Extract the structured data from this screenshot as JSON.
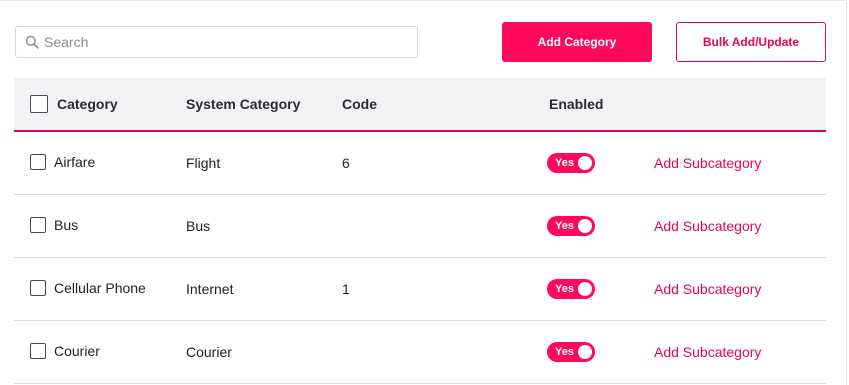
{
  "search": {
    "placeholder": "Search",
    "value": ""
  },
  "toolbar": {
    "add_category_label": "Add Category",
    "bulk_label": "Bulk Add/Update"
  },
  "table": {
    "headers": {
      "category": "Category",
      "system_category": "System Category",
      "code": "Code",
      "enabled": "Enabled"
    },
    "rows": [
      {
        "category": "Airfare",
        "system_category": "Flight",
        "code": "6",
        "enabled": "Yes",
        "action": "Add Subcategory"
      },
      {
        "category": "Bus",
        "system_category": "Bus",
        "code": "",
        "enabled": "Yes",
        "action": "Add Subcategory"
      },
      {
        "category": "Cellular Phone",
        "system_category": "Internet",
        "code": "1",
        "enabled": "Yes",
        "action": "Add Subcategory"
      },
      {
        "category": "Courier",
        "system_category": "Courier",
        "code": "",
        "enabled": "Yes",
        "action": "Add Subcategory"
      }
    ]
  },
  "colors": {
    "accent": "#ff0a5a",
    "link": "#e8064f",
    "header_bg": "#f3f3f5"
  }
}
